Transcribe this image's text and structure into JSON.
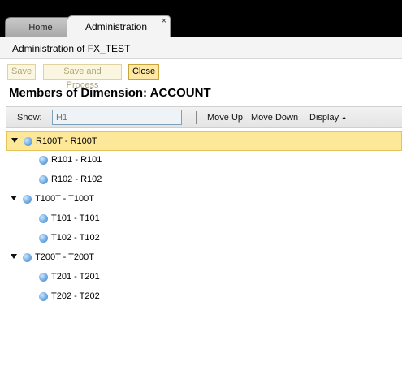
{
  "tabs": [
    {
      "label": "Home"
    },
    {
      "label": "Administration",
      "close": "×"
    }
  ],
  "page": {
    "title": "Administration of FX_TEST"
  },
  "buttons": {
    "save": "Save",
    "save_and_process": "Save and Process",
    "close": "Close"
  },
  "section": {
    "title": "Members of Dimension: ACCOUNT"
  },
  "toolbar": {
    "show_label": "Show:",
    "show_placeholder": "H1",
    "move_up": "Move Up",
    "move_down": "Move Down",
    "display": "Display",
    "display_icon": "▲"
  },
  "tree": {
    "expand_icon": "triangle-down-icon",
    "node_icon": "blue-sphere-icon",
    "selected_color": "#fde89a",
    "nodes": [
      {
        "label": "R100T - R100T",
        "level": 0,
        "expanded": true,
        "selected": true
      },
      {
        "label": "R101 - R101",
        "level": 1
      },
      {
        "label": "R102 - R102",
        "level": 1
      },
      {
        "label": "T100T - T100T",
        "level": 0,
        "expanded": true
      },
      {
        "label": "T101 - T101",
        "level": 1
      },
      {
        "label": "T102 - T102",
        "level": 1
      },
      {
        "label": "T200T - T200T",
        "level": 0,
        "expanded": true
      },
      {
        "label": "T201 - T201",
        "level": 1
      },
      {
        "label": "T202 - T202",
        "level": 1
      }
    ]
  }
}
